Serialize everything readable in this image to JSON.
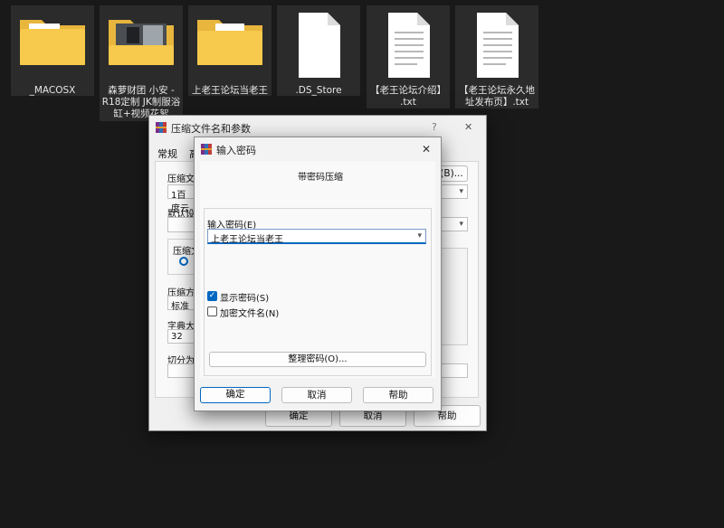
{
  "desktop": {
    "files": [
      {
        "label": "_MACOSX",
        "type": "folder"
      },
      {
        "label": "森萝财团 小安 -\nR18定制 JK制服浴\n缸+视频花絮",
        "type": "folder-photo"
      },
      {
        "label": "上老王论坛当老王",
        "type": "folder"
      },
      {
        "label": ".DS_Store",
        "type": "file-blank"
      },
      {
        "label": "【老王论坛介绍】\n.txt",
        "type": "file-text"
      },
      {
        "label": "【老王论坛永久地\n址发布页】.txt",
        "type": "file-text"
      }
    ]
  },
  "back_dialog": {
    "title": "压缩文件名和参数",
    "help_glyph": "?",
    "close_glyph": "✕",
    "tabs": [
      "常规",
      "高"
    ],
    "archive_name_label": "压缩文",
    "archive_name_value": "1百度云",
    "browse_label": "(B)...",
    "profile_label": "默认设置",
    "format_label": "压缩文",
    "method_label": "压缩方",
    "method_value": "标准",
    "dict_label": "字典大小",
    "dict_value": "32",
    "split_label": "切分为分",
    "ok_label": "确定",
    "cancel_label": "取消",
    "help_label": "帮助"
  },
  "password_dialog": {
    "title": "输入密码",
    "close_glyph": "✕",
    "group_label": "带密码压缩",
    "enter_label": "输入密码(E)",
    "password_value": "上老王论坛当老王",
    "show_password_label": "显示密码(S)",
    "show_password_checked": true,
    "encrypt_names_label": "加密文件名(N)",
    "encrypt_names_checked": false,
    "organize_label": "整理密码(O)...",
    "ok_label": "确定",
    "cancel_label": "取消",
    "help_label": "帮助"
  },
  "colors": {
    "folder": "#f7c94c",
    "accent": "#0067c0",
    "desktop": "#191919"
  }
}
